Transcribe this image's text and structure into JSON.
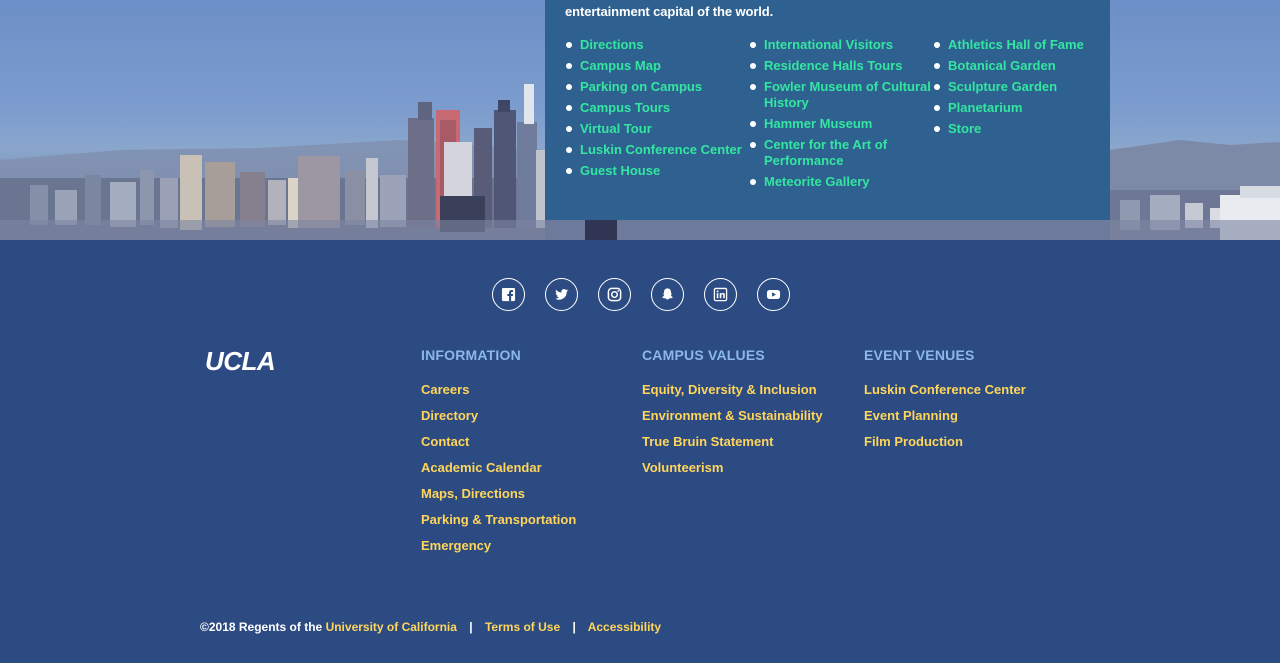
{
  "info_panel": {
    "intro": "entertainment capital of the world.",
    "columns": [
      [
        "Directions",
        "Campus Map",
        "Parking on Campus",
        "Campus Tours",
        "Virtual Tour",
        "Luskin Conference Center",
        "Guest House"
      ],
      [
        "International Visitors",
        "Residence Halls Tours",
        "Fowler Museum of Cultural History",
        "Hammer Museum",
        "Center for the Art of Performance",
        "Meteorite Gallery"
      ],
      [
        "Athletics Hall of Fame",
        "Botanical Garden",
        "Sculpture Garden",
        "Planetarium",
        "Store"
      ]
    ]
  },
  "social": [
    {
      "name": "facebook-icon"
    },
    {
      "name": "twitter-icon"
    },
    {
      "name": "instagram-icon"
    },
    {
      "name": "snapchat-icon"
    },
    {
      "name": "linkedin-icon"
    },
    {
      "name": "youtube-icon"
    }
  ],
  "footer": {
    "logo": "UCLA",
    "information": {
      "heading": "INFORMATION",
      "links": [
        "Careers",
        "Directory",
        "Contact",
        "Academic Calendar",
        "Maps, Directions",
        "Parking & Transportation",
        "Emergency"
      ]
    },
    "campus_values": {
      "heading": "CAMPUS VALUES",
      "links": [
        "Equity, Diversity & Inclusion",
        "Environment & Sustainability",
        "True Bruin Statement",
        "Volunteerism"
      ]
    },
    "event_venues": {
      "heading": "EVENT VENUES",
      "links": [
        "Luskin Conference Center",
        "Event Planning",
        "Film Production"
      ]
    }
  },
  "legal": {
    "copyright": "©2018 Regents of the",
    "uc_link": "University of California",
    "separator": "|",
    "terms": "Terms of Use",
    "accessibility": "Accessibility"
  },
  "colors": {
    "footer_bg": "#2b4b82",
    "panel_bg": "#2f6190",
    "panel_link": "#33e6a0",
    "footer_link": "#ffd55a",
    "heading": "#8bb8e8"
  }
}
